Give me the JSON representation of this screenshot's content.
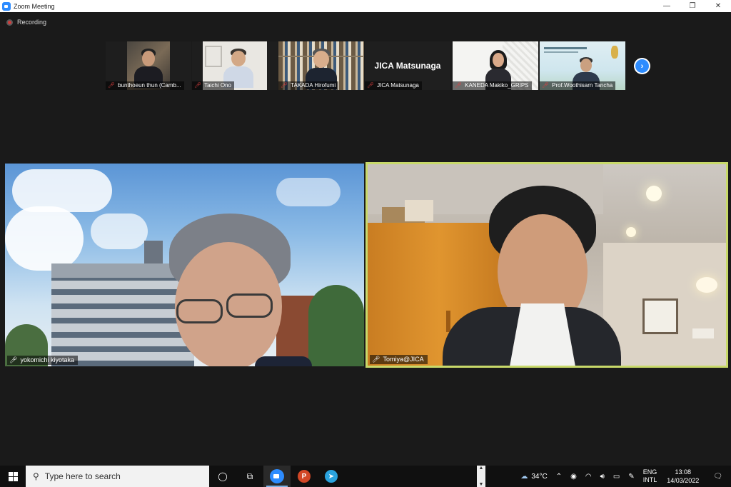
{
  "window": {
    "title": "Zoom Meeting",
    "minimize": "—",
    "restore": "❐",
    "close": "✕"
  },
  "recording": {
    "label": "Recording"
  },
  "thumbnails": [
    {
      "name": "bunthoeun thun (Camb..."
    },
    {
      "name": "Taichi Ono"
    },
    {
      "name": "TAKADA Hirofumi"
    },
    {
      "name": "JICA Matsunaga",
      "display_text": "JICA Matsunaga"
    },
    {
      "name": "KANEDA Makiko_GRIPS"
    },
    {
      "name": "Prof.Woothisarn Tancha"
    }
  ],
  "next_page_icon": "chevron-right-icon",
  "tiles": [
    {
      "name": "yokomichi kiyotaka"
    },
    {
      "name": "Tomiya@JICA",
      "active_speaker": true,
      "highlight_color": "#c8d96a"
    }
  ],
  "taskbar": {
    "search_placeholder": "Type here to search",
    "weather": "34°C",
    "lang_top": "ENG",
    "lang_bottom": "INTL",
    "time": "13:08",
    "date": "14/03/2022"
  },
  "colors": {
    "zoom_blue": "#2d8cff",
    "muted_red": "#e04040",
    "record_red": "#d23a3a"
  }
}
